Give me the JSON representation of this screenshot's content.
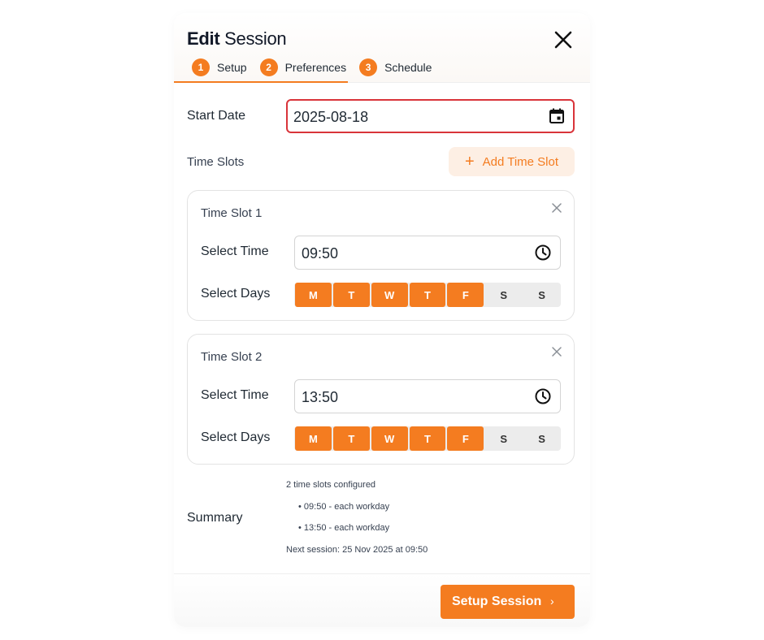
{
  "header": {
    "title_bold": "Edit",
    "title_rest": " Session",
    "tabs": [
      {
        "num": "1",
        "label": "Setup"
      },
      {
        "num": "2",
        "label": "Preferences"
      },
      {
        "num": "3",
        "label": "Schedule"
      }
    ],
    "close_icon": "close-icon"
  },
  "form": {
    "start_date_label": "Start Date",
    "start_date_value": "2025-08-18",
    "date_icon": "calendar-icon",
    "time_slots_label": "Time Slots",
    "add_slot_plus": "+",
    "add_slot_label": "Add Time Slot"
  },
  "slots": [
    {
      "title": "Time Slot 1",
      "time_label": "Select Time",
      "time_value": "09:50",
      "days_label": "Select Days",
      "days": [
        {
          "label": "M",
          "on": true
        },
        {
          "label": "T",
          "on": true
        },
        {
          "label": "W",
          "on": true
        },
        {
          "label": "T",
          "on": true
        },
        {
          "label": "F",
          "on": true
        },
        {
          "label": "S",
          "on": false
        },
        {
          "label": "S",
          "on": false
        }
      ]
    },
    {
      "title": "Time Slot 2",
      "time_label": "Select Time",
      "time_value": "13:50",
      "days_label": "Select Days",
      "days": [
        {
          "label": "M",
          "on": true
        },
        {
          "label": "T",
          "on": true
        },
        {
          "label": "W",
          "on": true
        },
        {
          "label": "T",
          "on": true
        },
        {
          "label": "F",
          "on": true
        },
        {
          "label": "S",
          "on": false
        },
        {
          "label": "S",
          "on": false
        }
      ]
    }
  ],
  "summary": {
    "label": "Summary",
    "line1": "2 time slots configured",
    "line2": "• 09:50 - each workday",
    "line3": "• 13:50 - each workday",
    "line4": "Next session: 25 Nov 2025 at 09:50"
  },
  "footer": {
    "button_label": "Setup Session",
    "button_chevron": "›"
  },
  "colors": {
    "accent": "#f47c20",
    "error_border": "#d9343a",
    "accent_soft": "#fdefe4"
  }
}
